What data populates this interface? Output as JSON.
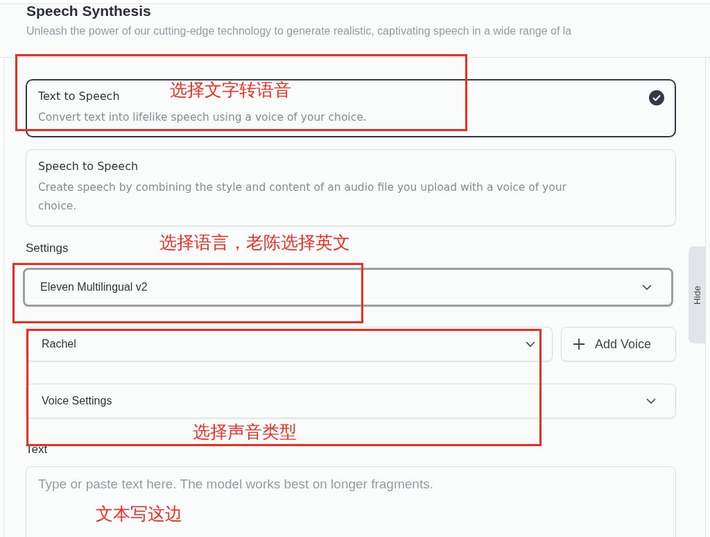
{
  "header": {
    "title": "Speech Synthesis",
    "subtitle": "Unleash the power of our cutting-edge technology to generate realistic, captivating speech in a wide range of la"
  },
  "modes": [
    {
      "title": "Text to Speech",
      "description": "Convert text into lifelike speech using a voice of your choice.",
      "selected": true
    },
    {
      "title": "Speech to Speech",
      "description": "Create speech by combining the style and content of an audio file you upload with a voice of your choice.",
      "selected": false
    }
  ],
  "settings": {
    "label": "Settings",
    "model": "Eleven Multilingual v2",
    "voice": "Rachel",
    "add_voice": "Add Voice",
    "voice_settings": "Voice Settings"
  },
  "text": {
    "label": "Text",
    "placeholder": "Type or paste text here. The model works best on longer fragments."
  },
  "side_tab": "Hide",
  "annotations": [
    {
      "text": "选择文字转语音",
      "boxed": true
    },
    {
      "text": "选择语言，老陈选择英文",
      "boxed": true
    },
    {
      "text": "选择声音类型",
      "boxed": true
    },
    {
      "text": "文本写这边",
      "boxed": false
    }
  ]
}
